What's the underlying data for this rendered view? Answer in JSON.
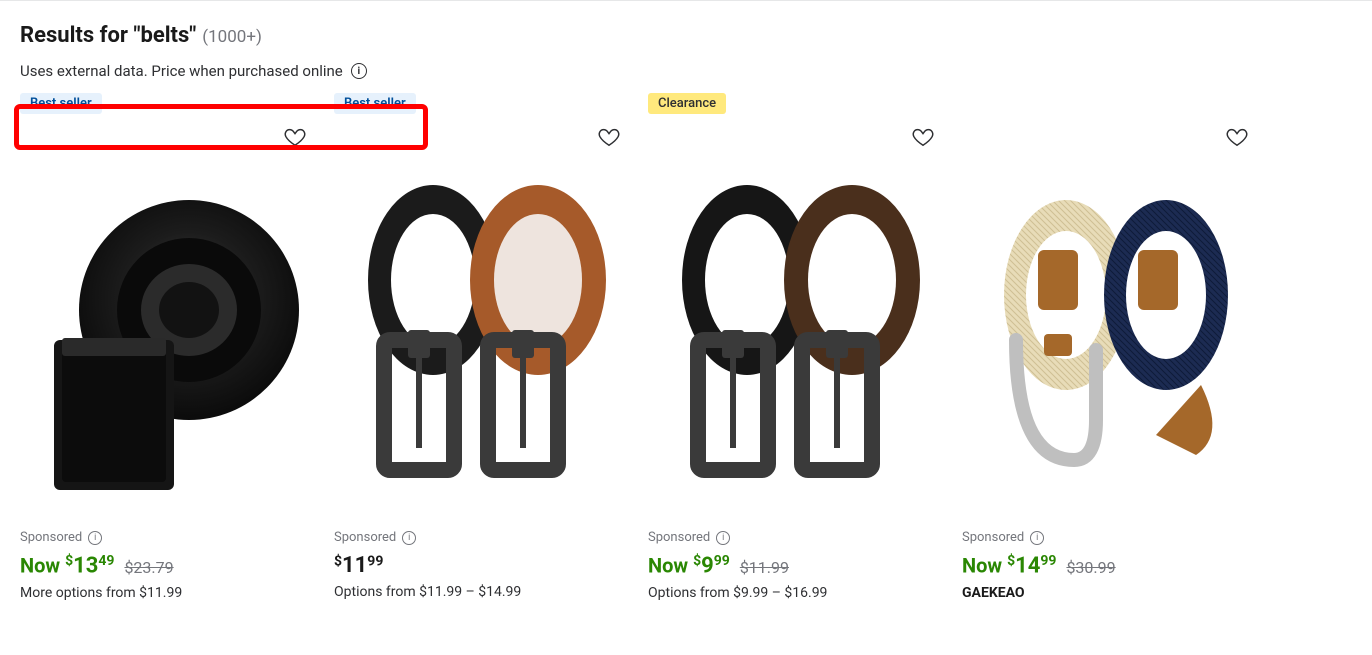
{
  "header": {
    "results_prefix": "Results for ",
    "results_query": "\"belts\"",
    "results_count": "(1000+)",
    "data_notice": "Uses external data. Price when purchased online"
  },
  "badges": {
    "bestseller": "Best seller",
    "clearance": "Clearance"
  },
  "common": {
    "sponsored": "Sponsored"
  },
  "products": [
    {
      "badge": "bestseller",
      "now_label": "Now ",
      "currency": "$",
      "price_whole": "13",
      "price_cents": "49",
      "strike": "$23.79",
      "subtext": "More options from $11.99"
    },
    {
      "badge": "bestseller",
      "currency": "$",
      "price_whole": "11",
      "price_cents": "99",
      "subtext": "Options from $11.99 – $14.99"
    },
    {
      "badge": "clearance",
      "now_label": "Now ",
      "currency": "$",
      "price_whole": "9",
      "price_cents": "99",
      "strike": "$11.99",
      "subtext": "Options from $9.99 – $16.99"
    },
    {
      "badge": null,
      "now_label": "Now ",
      "currency": "$",
      "price_whole": "14",
      "price_cents": "99",
      "strike": "$30.99",
      "brand": "GAEKEAO"
    }
  ]
}
